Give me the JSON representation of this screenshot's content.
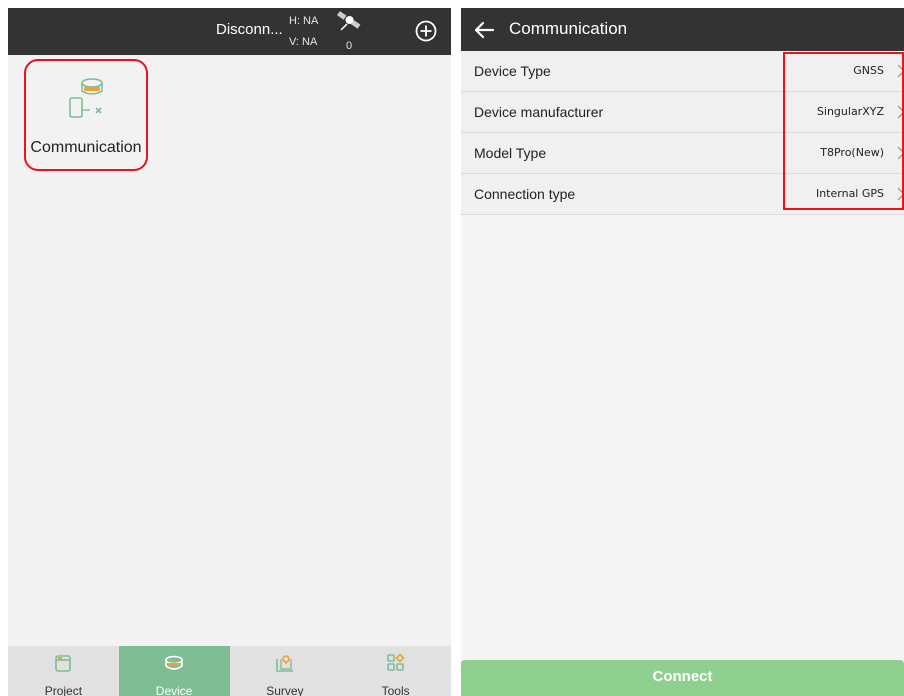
{
  "left": {
    "status": {
      "connection_text": "Disconn...",
      "h_label": "H: NA",
      "v_label": "V: NA",
      "satellite_count": "0"
    },
    "tile": {
      "label": "Communication",
      "icon": "gnss-receiver-phone-icon"
    },
    "nav": [
      {
        "label": "Project",
        "icon": "project-icon",
        "active": false
      },
      {
        "label": "Device",
        "icon": "device-icon",
        "active": true
      },
      {
        "label": "Survey",
        "icon": "survey-icon",
        "active": false
      },
      {
        "label": "Tools",
        "icon": "tools-icon",
        "active": false
      }
    ]
  },
  "right": {
    "header": {
      "title": "Communication"
    },
    "rows": [
      {
        "label": "Device Type",
        "value": "GNSS"
      },
      {
        "label": "Device manufacturer",
        "value": "SingularXYZ"
      },
      {
        "label": "Model Type",
        "value": "T8Pro(New)"
      },
      {
        "label": "Connection type",
        "value": "Internal GPS"
      }
    ],
    "connect_label": "Connect"
  },
  "colors": {
    "header_bg": "#333333",
    "accent_green": "#7fbd95",
    "connect_green": "#8fcf8f",
    "highlight_red": "#e8131b"
  }
}
